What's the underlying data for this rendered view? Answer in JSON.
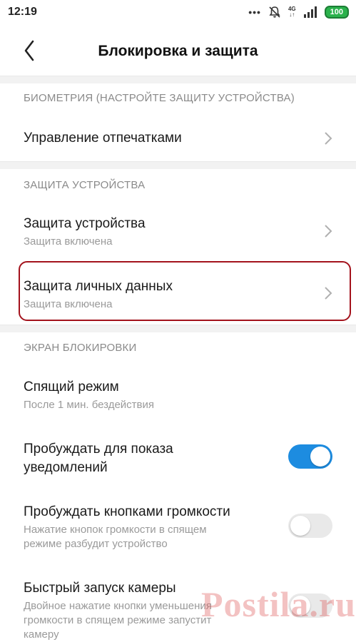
{
  "status_bar": {
    "time": "12:19",
    "network": "4G",
    "battery": "100"
  },
  "header": {
    "title": "Блокировка и защита"
  },
  "sections": {
    "biometry": {
      "header": "БИОМЕТРИЯ (НАСТРОЙТЕ ЗАЩИТУ УСТРОЙСТВА)",
      "fingerprints": {
        "title": "Управление отпечатками"
      }
    },
    "device_protection": {
      "header": "ЗАЩИТА УСТРОЙСТВА",
      "device": {
        "title": "Защита устройства",
        "subtitle": "Защита включена"
      },
      "privacy": {
        "title": "Защита личных данных",
        "subtitle": "Защита включена"
      }
    },
    "lock_screen": {
      "header": "ЭКРАН БЛОКИРОВКИ",
      "sleep": {
        "title": "Спящий режим",
        "subtitle": "После 1 мин. бездействия"
      },
      "wake_notifications": {
        "title_line1": "Пробуждать для показа",
        "title_line2": "уведомлений",
        "enabled": true
      },
      "wake_volume": {
        "title": "Пробуждать кнопками громкости",
        "subtitle_line1": "Нажатие кнопок громкости в спящем",
        "subtitle_line2": "режиме разбудит устройство",
        "enabled": false
      },
      "quick_camera": {
        "title": "Быстрый запуск камеры",
        "subtitle_line1": "Двойное нажатие кнопки уменьшения",
        "subtitle_line2": "громкости в спящем режиме запустит",
        "subtitle_line3": "камеру"
      }
    }
  },
  "watermark": "Postila.ru",
  "colors": {
    "toggle_on": "#1d8ce0",
    "toggle_off": "#e9e9e9",
    "highlight_border": "#a3121c",
    "battery": "#2bb24c"
  },
  "icons": [
    "back-arrow-icon",
    "chevron-right-icon",
    "mute-icon",
    "signal-icon"
  ]
}
